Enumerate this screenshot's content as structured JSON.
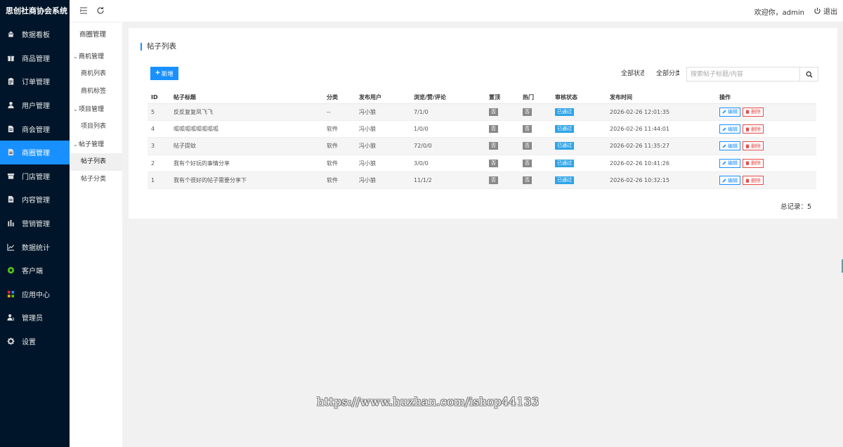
{
  "brand": "思创社商协会系统",
  "nav": [
    {
      "label": "数据看板",
      "icon": "home-icon"
    },
    {
      "label": "商品管理",
      "icon": "gift-icon"
    },
    {
      "label": "订单管理",
      "icon": "clipboard-icon"
    },
    {
      "label": "用户管理",
      "icon": "user-icon"
    },
    {
      "label": "商会管理",
      "icon": "document-icon"
    },
    {
      "label": "商圈管理",
      "icon": "document-icon"
    },
    {
      "label": "门店管理",
      "icon": "store-icon"
    },
    {
      "label": "内容管理",
      "icon": "document-icon"
    },
    {
      "label": "营销管理",
      "icon": "bar-chart-icon"
    },
    {
      "label": "数据统计",
      "icon": "line-chart-icon"
    },
    {
      "label": "客户端",
      "icon": "client-icon"
    },
    {
      "label": "应用中心",
      "icon": "apps-icon"
    },
    {
      "label": "管理员",
      "icon": "admin-icon"
    },
    {
      "label": "设置",
      "icon": "gear-icon"
    }
  ],
  "nav_active_index": 5,
  "sub": {
    "title": "商圈管理",
    "groups": [
      {
        "label": "商机管理",
        "items": [
          "商机列表",
          "商机标签"
        ]
      },
      {
        "label": "项目管理",
        "items": [
          "项目列表"
        ]
      },
      {
        "label": "帖子管理",
        "items": [
          "帖子列表",
          "帖子分类"
        ]
      }
    ],
    "active_item": "帖子列表"
  },
  "header": {
    "welcome": "欢迎你，admin",
    "logout": "退出"
  },
  "card": {
    "title": "帖子列表",
    "add_button": "新增",
    "filter_status": "全部状态",
    "filter_category": "全部分类",
    "search_placeholder": "搜索帖子标题/内容"
  },
  "table": {
    "columns": [
      "ID",
      "帖子标题",
      "分类",
      "发布用户",
      "浏览/赞/评论",
      "置顶",
      "热门",
      "审核状态",
      "发布时间",
      "操作"
    ],
    "rows": [
      {
        "id": "5",
        "title": "反反复复凤飞飞",
        "category": "--",
        "user": "冯小狼",
        "stats": "7/1/0",
        "top": "否",
        "hot": "否",
        "status": "已通过",
        "time": "2026-02-26 12:01:35"
      },
      {
        "id": "4",
        "title": "呱呱呱呱呱呱呱呱",
        "category": "软件",
        "user": "冯小狼",
        "stats": "1/0/0",
        "top": "否",
        "hot": "否",
        "status": "已通过",
        "time": "2026-02-26 11:44:01"
      },
      {
        "id": "3",
        "title": "帖子提蚊",
        "category": "软件",
        "user": "冯小狼",
        "stats": "72/0/0",
        "top": "否",
        "hot": "否",
        "status": "已通过",
        "time": "2026-02-26 11:35:27"
      },
      {
        "id": "2",
        "title": "我有个好玩的事情分享",
        "category": "软件",
        "user": "冯小狼",
        "stats": "3/0/0",
        "top": "否",
        "hot": "否",
        "status": "已通过",
        "time": "2026-02-26 10:41:26"
      },
      {
        "id": "1",
        "title": "我有个很好的帖子需要分享下",
        "category": "软件",
        "user": "冯小狼",
        "stats": "11/1/2",
        "top": "否",
        "hot": "否",
        "status": "已通过",
        "time": "2026-02-26 10:32:15"
      }
    ],
    "edit_label": "编辑",
    "delete_label": "删除"
  },
  "total": "总记录：5",
  "watermark": "https://www.huzhan.com/ishop44133",
  "colors": {
    "sidebar": "#001529",
    "accent": "#1890ff",
    "danger": "#e64a4a",
    "approved": "#2fa4e7",
    "tag_gray": "#888888"
  }
}
